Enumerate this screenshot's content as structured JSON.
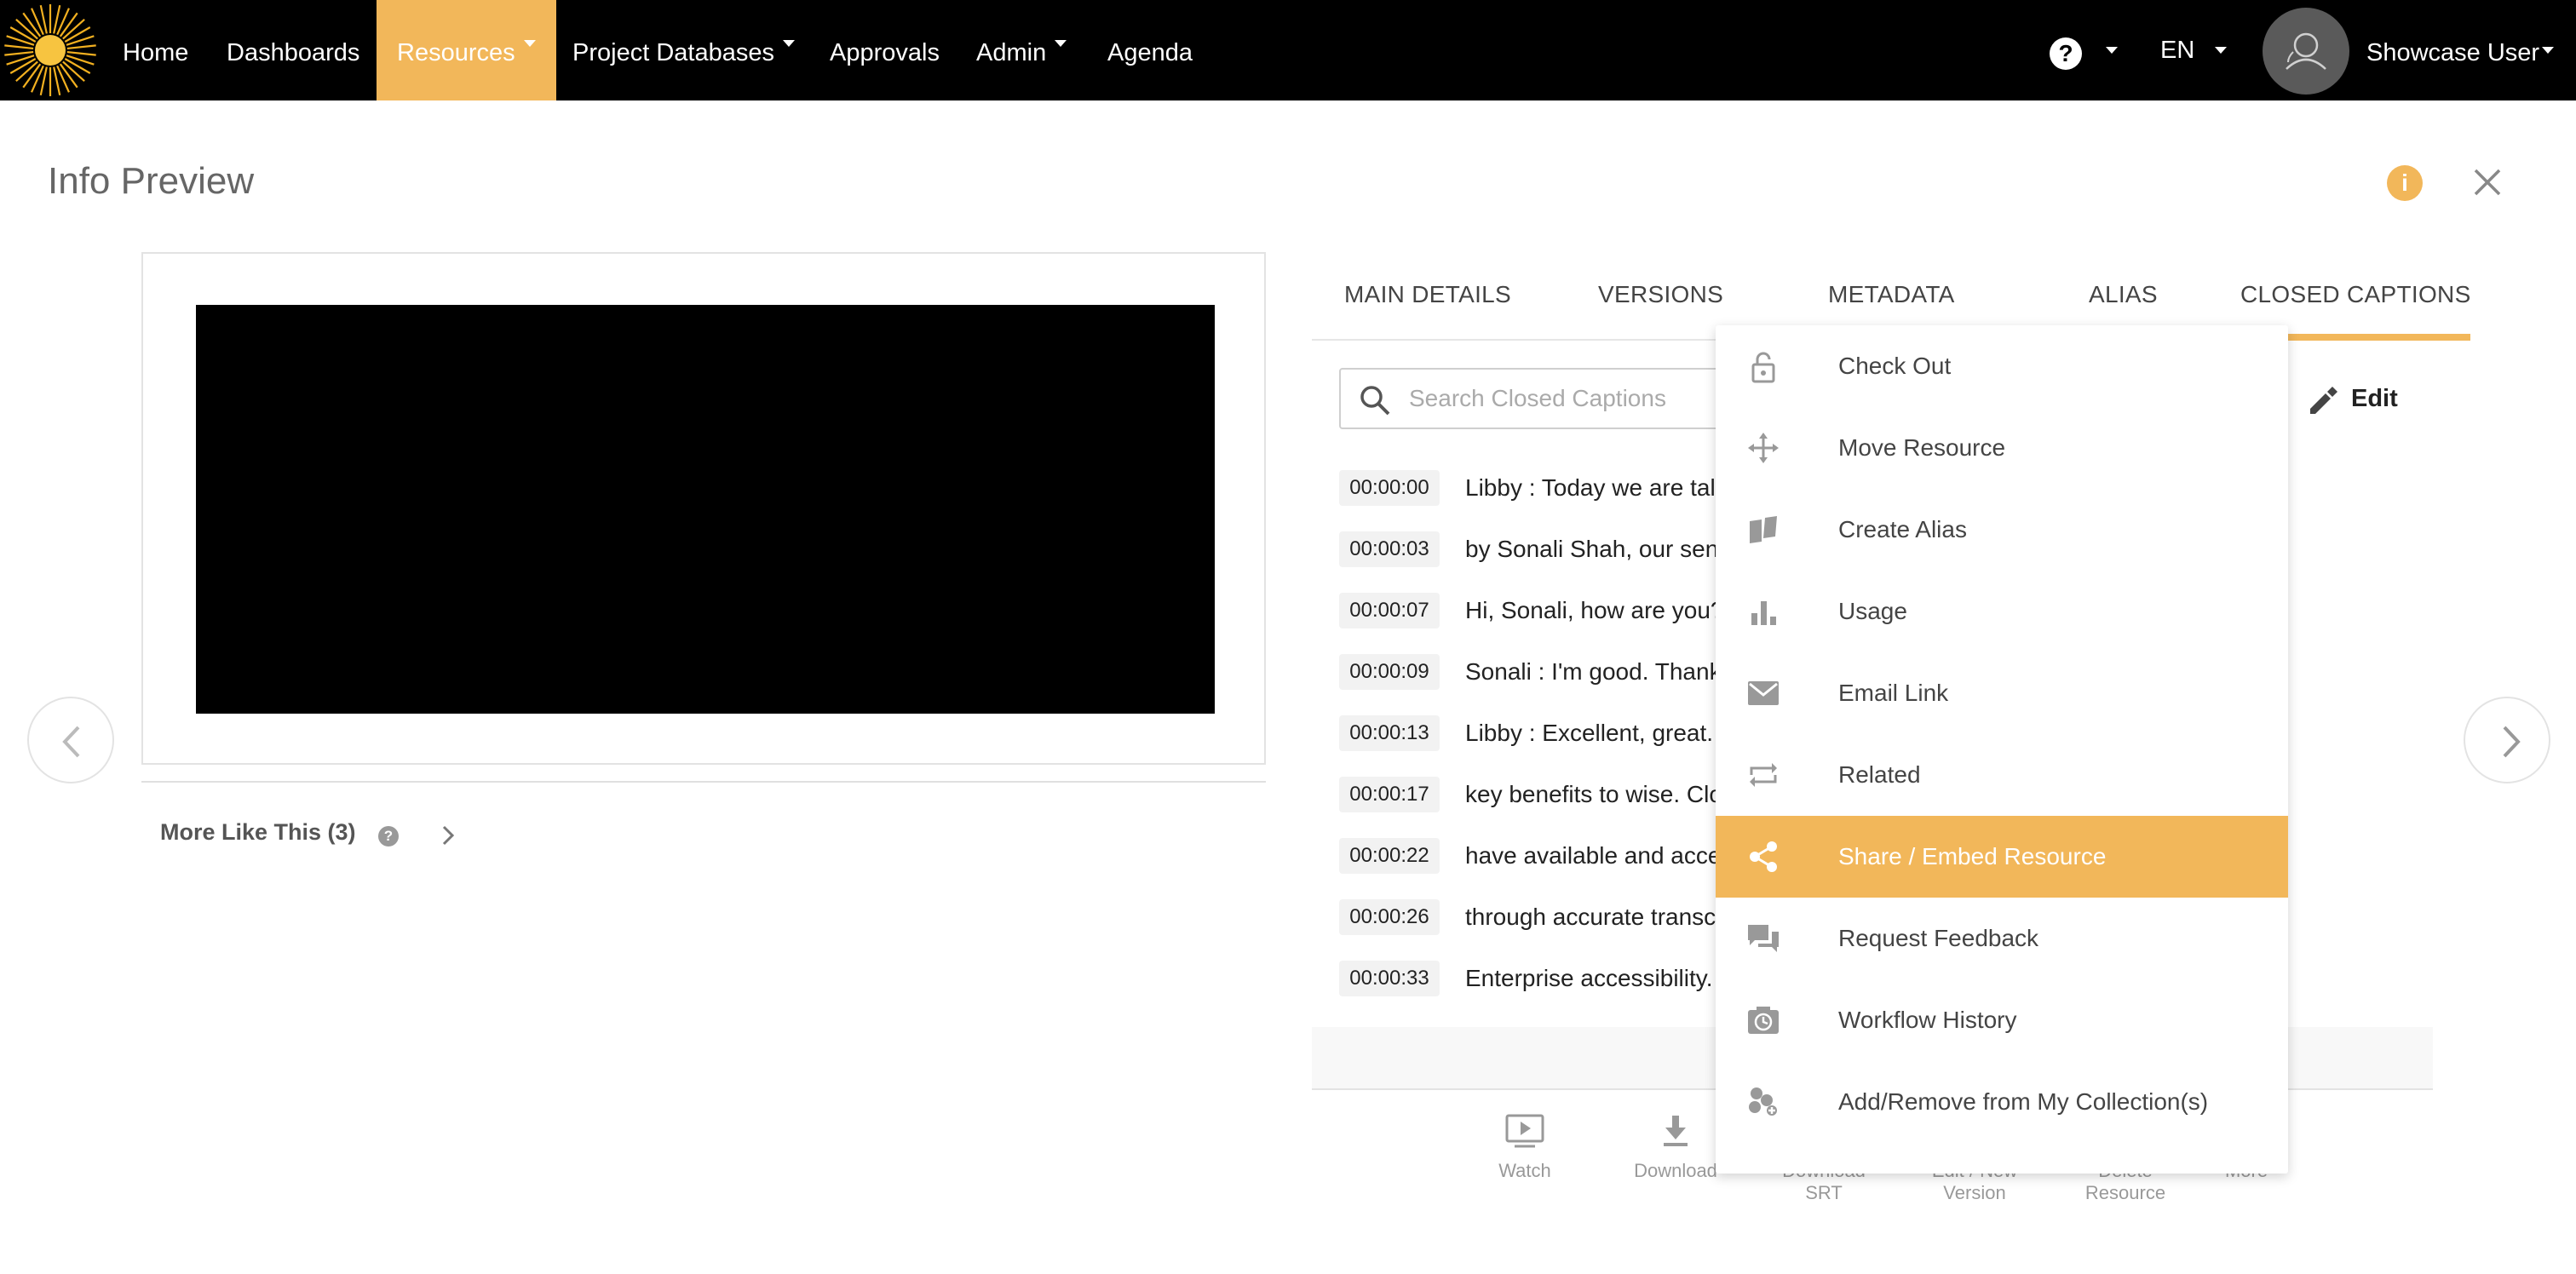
{
  "nav": {
    "home": "Home",
    "dashboards": "Dashboards",
    "resources": "Resources",
    "project_databases": "Project Databases",
    "approvals": "Approvals",
    "admin": "Admin",
    "agenda": "Agenda",
    "help": "?",
    "language": "EN",
    "user": "Showcase User"
  },
  "header": {
    "title": "Info Preview",
    "info": "i"
  },
  "more_like_this": {
    "label": "More Like This (3)",
    "help": "?"
  },
  "tabs": [
    {
      "label": "MAIN DETAILS"
    },
    {
      "label": "VERSIONS"
    },
    {
      "label": "METADATA"
    },
    {
      "label": "ALIAS"
    },
    {
      "label": "CLOSED CAPTIONS",
      "active": true
    }
  ],
  "cc": {
    "search_placeholder": "Search Closed Captions",
    "edit_label": "Edit",
    "rows": [
      {
        "time": "00:00:00",
        "text": "Libby : Today we are tal"
      },
      {
        "time": "00:00:03",
        "text": "by Sonali Shah, our sen"
      },
      {
        "time": "00:00:07",
        "text": "Hi, Sonali, how are you?"
      },
      {
        "time": "00:00:09",
        "text": "Sonali : I'm good. Thank"
      },
      {
        "time": "00:00:13",
        "text": "Libby : Excellent, great."
      },
      {
        "time": "00:00:17",
        "text": "key benefits to wise. Clo"
      },
      {
        "time": "00:00:22",
        "text": "have available and acce"
      },
      {
        "time": "00:00:26",
        "text": "through accurate transc"
      },
      {
        "time": "00:00:33",
        "text": "Enterprise accessibility."
      }
    ]
  },
  "actions": [
    {
      "label": "Watch",
      "icon": "play-icon"
    },
    {
      "label": "Download",
      "icon": "download-icon"
    },
    {
      "label": "Download SRT",
      "icon": "download-srt-icon"
    },
    {
      "label": "Edit / New Version",
      "icon": "edit-icon"
    },
    {
      "label": "Delete Resource",
      "icon": "trash-icon"
    },
    {
      "label": "More",
      "icon": "more-icon"
    }
  ],
  "menu": {
    "highlight_color": "#f2b75a",
    "items": [
      {
        "label": "Check Out",
        "icon": "lock-open-icon"
      },
      {
        "label": "Move Resource",
        "icon": "move-icon"
      },
      {
        "label": "Create Alias",
        "icon": "alias-icon"
      },
      {
        "label": "Usage",
        "icon": "bar-chart-icon"
      },
      {
        "label": "Email Link",
        "icon": "email-icon"
      },
      {
        "label": "Related",
        "icon": "repeat-icon"
      },
      {
        "label": "Share / Embed Resource",
        "icon": "share-icon",
        "highlighted": true
      },
      {
        "label": "Request Feedback",
        "icon": "chat-icon"
      },
      {
        "label": "Workflow History",
        "icon": "history-icon"
      },
      {
        "label": "Add/Remove from My Collection(s)",
        "icon": "collection-icon"
      }
    ]
  }
}
